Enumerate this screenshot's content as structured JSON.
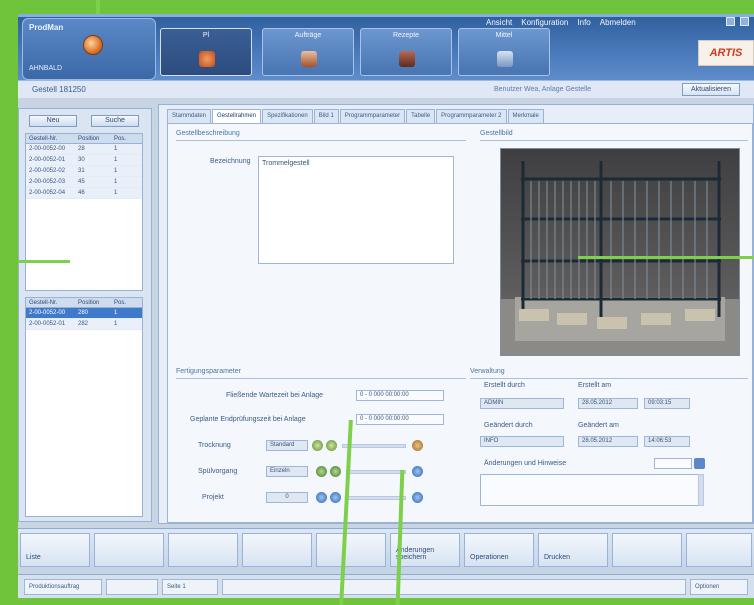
{
  "header": {
    "product": "ProdMan",
    "subtitle": "AHNBALD",
    "modules": [
      {
        "label": "Pl",
        "icon": "production-icon",
        "color": "#d86a2a"
      },
      {
        "label": "Aufträge",
        "icon": "orders-icon",
        "color": "#c7643a"
      },
      {
        "label": "Rezepte",
        "icon": "recipe-icon",
        "color": "#8a3f2c"
      },
      {
        "label": "Mittel",
        "icon": "tools-icon",
        "color": "#6e8fb5"
      }
    ],
    "menu": [
      "Ansicht",
      "Konfiguration",
      "Info",
      "Abmelden"
    ],
    "brand_text": "ARTIS",
    "left_caption": "Gestell 181250",
    "center_caption": "Benutzer Wea, Anlage Gestelle",
    "action_label": "Aktualisieren"
  },
  "left_panel": {
    "btn_left": "Neu",
    "btn_right": "Suche",
    "grid1": {
      "headers": [
        "Gestell-Nr.",
        "Position",
        "Pos."
      ],
      "rows": [
        [
          "2-00-0052-00",
          "28",
          "1"
        ],
        [
          "2-00-0052-01",
          "30",
          "1"
        ],
        [
          "2-00-0052-02",
          "31",
          "1"
        ],
        [
          "2-00-0052-03",
          "45",
          "1"
        ],
        [
          "2-00-0052-04",
          "46",
          "1"
        ]
      ]
    },
    "grid2": {
      "headers": [
        "Gestell-Nr.",
        "Position",
        "Pos."
      ],
      "rows": [
        [
          "2-00-0052-00",
          "280",
          "1"
        ],
        [
          "2-00-0052-01",
          "282",
          "1"
        ]
      ],
      "selected_index": 0
    }
  },
  "main": {
    "tabs": [
      "Stammdaten",
      "Gestellrahmen",
      "Spezifikationen",
      "Bild 1",
      "Programmparameter",
      "Tabelle",
      "Programmparameter 2",
      "Merkmale"
    ],
    "active_tab": 1,
    "description": {
      "section_title": "Gestellbeschreibung",
      "label": "Bezeichnung",
      "value": "Trommelgestell"
    },
    "image_section": {
      "title": "Gestellbild"
    },
    "tracking": {
      "title": "Fertigungsparameter",
      "row1_label": "Fließende Wartezeit bei Anlage",
      "row1_value": "0 - 0 000 00:00:00",
      "row2_label": "Geplante Endprüfungszeit bei Anlage",
      "row2_value": "0 - 0 000 00:00:00",
      "row3_label": "Trocknung",
      "row3_value": "Standard",
      "row4_label": "Spülvorgang",
      "row4_value": "Einzeln",
      "row5_label": "Projekt",
      "row5_value": "0"
    },
    "details": {
      "title": "Verwaltung",
      "created_by_label": "Erstellt durch",
      "created_label": "Erstellt am",
      "created_by_value": "ADMIN",
      "created_date": "28.05.2012",
      "created_time": "09:03:15",
      "changed_by_label": "Geändert durch",
      "changed_label": "Geändert am",
      "changed_by_value": "INFO",
      "changed_date": "28.05.2012",
      "changed_time": "14:06:53",
      "notes_label": "Änderungen und Hinweise"
    }
  },
  "toolbar": {
    "buttons": [
      "Liste",
      "",
      "",
      "",
      "",
      "Änderungen speichern",
      "Operationen",
      "Drucken",
      "",
      ""
    ]
  },
  "statusbar": {
    "left_text": "Produktionsauftrag",
    "page_text": "Seite 1",
    "right_text": "Optionen"
  },
  "colors": {
    "frame_green": "#6fc43c",
    "header_blue": "#3d6aa9",
    "selection_blue": "#3f79c9"
  }
}
